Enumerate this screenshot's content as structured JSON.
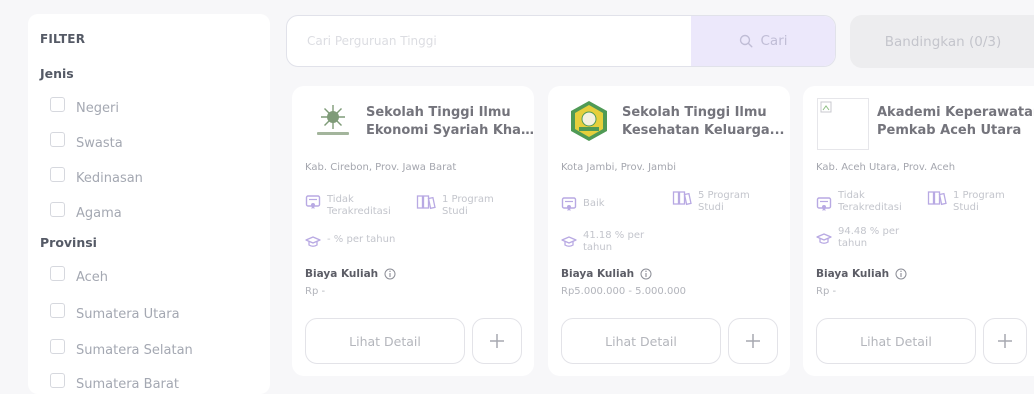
{
  "sidebar": {
    "title": "FILTER",
    "jenis": {
      "title": "Jenis",
      "options": [
        "Negeri",
        "Swasta",
        "Kedinasan",
        "Agama"
      ]
    },
    "provinsi": {
      "title": "Provinsi",
      "options": [
        "Aceh",
        "Sumatera Utara",
        "Sumatera Selatan",
        "Sumatera Barat"
      ]
    }
  },
  "search": {
    "placeholder": "Cari Perguruan Tinggi",
    "button_label": "Cari"
  },
  "compare_button": "Bandingkan (0/3)",
  "cards": [
    {
      "name_line1": "Sekolah Tinggi Ilmu",
      "name_line2": "Ekonomi Syariah Khas...",
      "location": "Kab. Cirebon, Prov. Jawa Barat",
      "accreditation_l1": "Tidak",
      "accreditation_l2": "Terakreditasi",
      "programs_l1": "1 Program",
      "programs_l2": "Studi",
      "graduation_l1": "- % per tahun",
      "graduation_l2": "",
      "fee_label": "Biaya Kuliah",
      "fee_value": "Rp -",
      "detail_label": "Lihat Detail"
    },
    {
      "name_line1": "Sekolah Tinggi Ilmu",
      "name_line2": "Kesehatan Keluarga...",
      "location": "Kota Jambi, Prov. Jambi",
      "accreditation_l1": "Baik",
      "accreditation_l2": "",
      "programs_l1": "5 Program",
      "programs_l2": "Studi",
      "graduation_l1": "41.18 % per",
      "graduation_l2": "tahun",
      "fee_label": "Biaya Kuliah",
      "fee_value": "Rp5.000.000 - 5.000.000",
      "detail_label": "Lihat Detail"
    },
    {
      "name_line1": "Akademi Keperawatan",
      "name_line2": "Pemkab Aceh Utara",
      "location": "Kab. Aceh Utara, Prov. Aceh",
      "accreditation_l1": "Tidak",
      "accreditation_l2": "Terakreditasi",
      "programs_l1": "1 Program",
      "programs_l2": "Studi",
      "graduation_l1": "94.48 % per",
      "graduation_l2": "tahun",
      "fee_label": "Biaya Kuliah",
      "fee_value": "Rp -",
      "detail_label": "Lihat Detail"
    }
  ],
  "colors": {
    "accent": "#ece8fb",
    "primary_text": "#5c5d66",
    "muted_text": "#a4a6ae",
    "stat_icon": "#b8a9e3"
  }
}
